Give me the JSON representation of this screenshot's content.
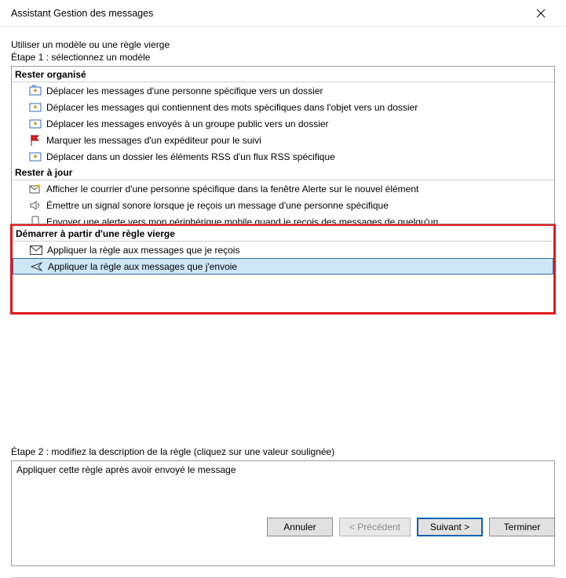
{
  "window": {
    "title": "Assistant Gestion des messages"
  },
  "intro": "Utiliser un modèle ou une règle vierge",
  "step1_label": "Étape 1 : sélectionnez un modèle",
  "sections": {
    "organized": {
      "header": "Rester organisé",
      "items": [
        "Déplacer les messages d'une personne spécifique vers un dossier",
        "Déplacer les messages qui contiennent des mots spécifiques dans l'objet vers un dossier",
        "Déplacer les messages envoyés à un groupe public vers un dossier",
        "Marquer les messages d'un expéditeur pour le suivi",
        "Déplacer dans un dossier les éléments RSS d'un flux RSS spécifique"
      ]
    },
    "uptodate": {
      "header": "Rester à jour",
      "items": [
        "Afficher le courrier d'une personne spécifique dans la fenêtre Alerte sur le nouvel élément",
        "Émettre un signal sonore lorsque je reçois un message d'une personne spécifique",
        "Envoyer une alerte vers mon périphérique mobile quand je reçois des messages de quelqu'un"
      ]
    },
    "blank": {
      "header": "Démarrer à partir d'une règle vierge",
      "items": [
        "Appliquer la règle aux messages que je reçois",
        "Appliquer la règle aux messages que j'envoie"
      ]
    }
  },
  "step2_label": "Étape 2 : modifiez la description de la règle (cliquez sur une valeur soulignée)",
  "description": "Appliquer cette règle après avoir envoyé le message",
  "buttons": {
    "cancel": "Annuler",
    "back": "< Précédent",
    "next": "Suivant >",
    "finish": "Terminer"
  }
}
